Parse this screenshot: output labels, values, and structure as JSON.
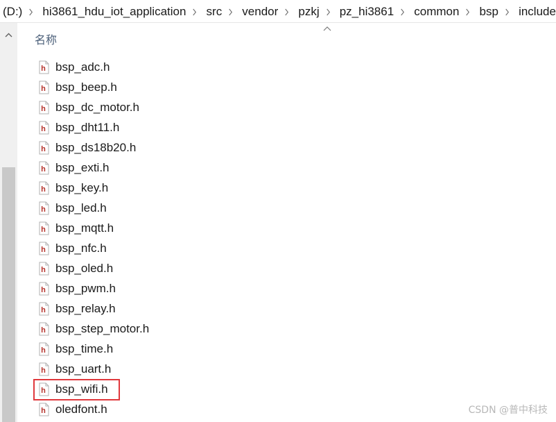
{
  "breadcrumb": {
    "segments": [
      "(D:)",
      "hi3861_hdu_iot_application",
      "src",
      "vendor",
      "pzkj",
      "pz_hi3861",
      "common",
      "bsp",
      "include"
    ],
    "separator_icon": "chevron-right-icon"
  },
  "scrollbar": {
    "up_icon": "chevron-up-icon"
  },
  "column_header": {
    "name_label": "名称",
    "sort_icon": "sort-ascending-icon"
  },
  "files": [
    {
      "name": "bsp_adc.h",
      "icon": "c-header-file-icon"
    },
    {
      "name": "bsp_beep.h",
      "icon": "c-header-file-icon"
    },
    {
      "name": "bsp_dc_motor.h",
      "icon": "c-header-file-icon"
    },
    {
      "name": "bsp_dht11.h",
      "icon": "c-header-file-icon"
    },
    {
      "name": "bsp_ds18b20.h",
      "icon": "c-header-file-icon"
    },
    {
      "name": "bsp_exti.h",
      "icon": "c-header-file-icon"
    },
    {
      "name": "bsp_key.h",
      "icon": "c-header-file-icon"
    },
    {
      "name": "bsp_led.h",
      "icon": "c-header-file-icon"
    },
    {
      "name": "bsp_mqtt.h",
      "icon": "c-header-file-icon"
    },
    {
      "name": "bsp_nfc.h",
      "icon": "c-header-file-icon"
    },
    {
      "name": "bsp_oled.h",
      "icon": "c-header-file-icon"
    },
    {
      "name": "bsp_pwm.h",
      "icon": "c-header-file-icon"
    },
    {
      "name": "bsp_relay.h",
      "icon": "c-header-file-icon"
    },
    {
      "name": "bsp_step_motor.h",
      "icon": "c-header-file-icon"
    },
    {
      "name": "bsp_time.h",
      "icon": "c-header-file-icon"
    },
    {
      "name": "bsp_uart.h",
      "icon": "c-header-file-icon"
    },
    {
      "name": "bsp_wifi.h",
      "icon": "c-header-file-icon",
      "highlighted": true
    },
    {
      "name": "oledfont.h",
      "icon": "c-header-file-icon"
    }
  ],
  "colors": {
    "highlight_border": "#e0383c",
    "header_label": "#4c607a",
    "icon_letter": "#b5322b"
  },
  "watermark": "CSDN @普中科技"
}
